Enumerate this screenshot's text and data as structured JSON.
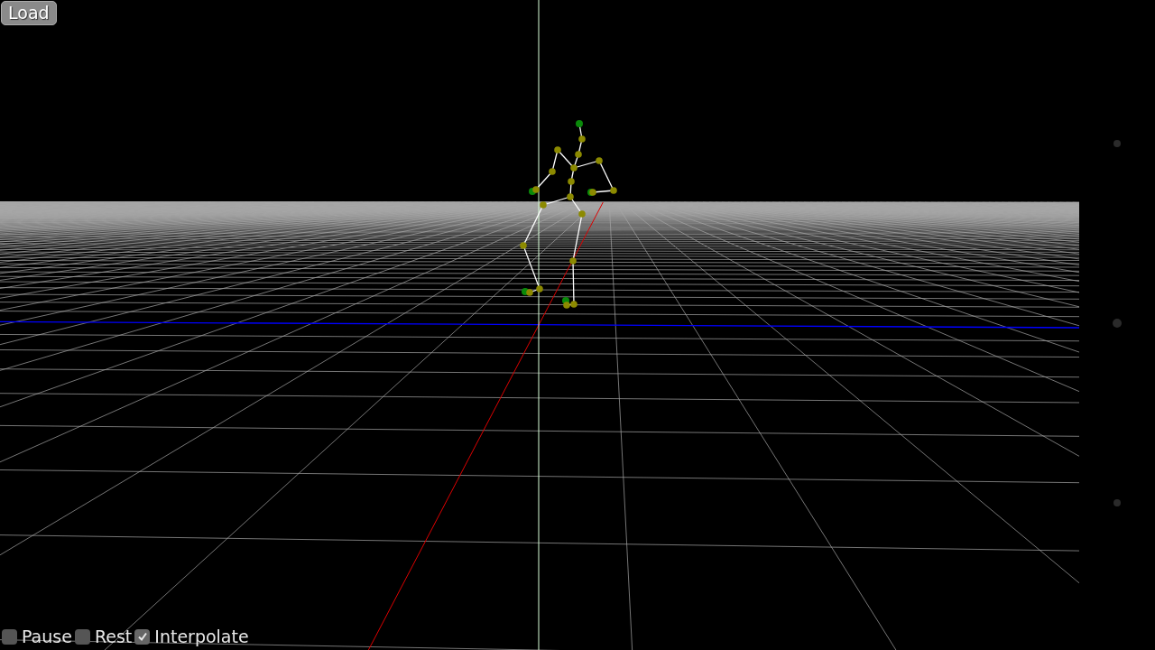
{
  "load_button": {
    "label": "Load"
  },
  "options": [
    {
      "label": "Pause",
      "checked": false
    },
    {
      "label": "Rest",
      "checked": false
    },
    {
      "label": "Interpolate",
      "checked": true
    }
  ]
}
